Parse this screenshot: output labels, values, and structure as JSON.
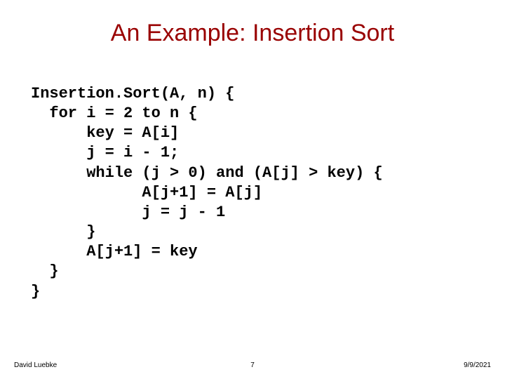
{
  "title": "An Example: Insertion Sort",
  "code": {
    "l1": "Insertion.Sort(A, n) {",
    "l2": "  for i = 2 to n {",
    "l3": "      key = A[i]",
    "l4": "      j = i - 1;",
    "l5": "      while (j > 0) and (A[j] > key) {",
    "l6": "            A[j+1] = A[j]",
    "l7": "            j = j - 1",
    "l8": "      }",
    "l9": "      A[j+1] = key",
    "l10": "  }",
    "l11": "}"
  },
  "footer": {
    "author": "David Luebke",
    "page": "7",
    "date": "9/9/2021"
  }
}
